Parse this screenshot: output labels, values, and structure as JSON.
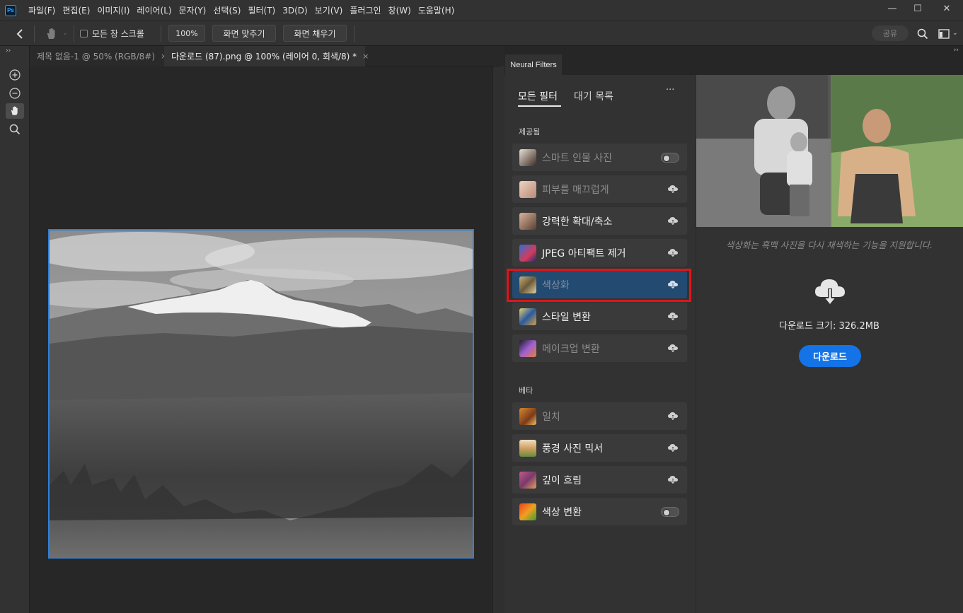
{
  "menubar": {
    "logo": "Ps",
    "items": [
      "파일(F)",
      "편집(E)",
      "이미지(I)",
      "레이어(L)",
      "문자(Y)",
      "선택(S)",
      "필터(T)",
      "3D(D)",
      "보기(V)",
      "플러그인",
      "창(W)",
      "도움말(H)"
    ],
    "window_controls": [
      "—",
      "☐",
      "✕"
    ]
  },
  "options": {
    "scroll_all_label": "모든 창 스크롤",
    "zoom": "100%",
    "fit_screen": "화면 맞추기",
    "fill_screen": "화면 채우기",
    "share": "공유"
  },
  "documents": {
    "tabs": [
      {
        "title": "제목 없음-1 @ 50% (RGB/8#)",
        "active": false
      },
      {
        "title": "다운로드 (87).png @ 100% (레이어 0, 회색/8) *",
        "active": true
      }
    ],
    "close": "×"
  },
  "neural_filters": {
    "panel_tab": "Neural Filters",
    "tabs": {
      "all": "모든 필터",
      "waitlist": "대기 목록"
    },
    "more": "···",
    "featured_label": "제공됨",
    "beta_label": "베타",
    "featured": [
      {
        "label": "스마트 인물 사진",
        "state": "toggle",
        "dim": true
      },
      {
        "label": "피부를 매끄럽게",
        "state": "cloud",
        "dim": true
      },
      {
        "label": "강력한 확대/축소",
        "state": "cloud",
        "dim": false
      },
      {
        "label": "JPEG 아티팩트 제거",
        "state": "cloud",
        "dim": false
      },
      {
        "label": "색상화",
        "state": "cloud",
        "dim": true,
        "selected": true
      },
      {
        "label": "스타일 변환",
        "state": "cloud",
        "dim": false
      },
      {
        "label": "메이크업 변환",
        "state": "cloud",
        "dim": true
      }
    ],
    "beta": [
      {
        "label": "일치",
        "state": "cloud",
        "dim": true
      },
      {
        "label": "풍경 사진 믹서",
        "state": "cloud",
        "dim": false
      },
      {
        "label": "깊이 흐림",
        "state": "cloud",
        "dim": false
      },
      {
        "label": "색상 변환",
        "state": "toggle",
        "dim": false
      }
    ],
    "detail": {
      "description": "색상화는 흑백 사진을 다시 채색하는 기능을 지원합니다.",
      "download_size": "다운로드 크기: 326.2MB",
      "download_button": "다운로드"
    }
  },
  "colors": {
    "accent": "#1473e6",
    "selected_row": "#234a71",
    "highlight_frame": "#e1141a",
    "panel": "#323232",
    "canvas_bg": "#272727"
  }
}
